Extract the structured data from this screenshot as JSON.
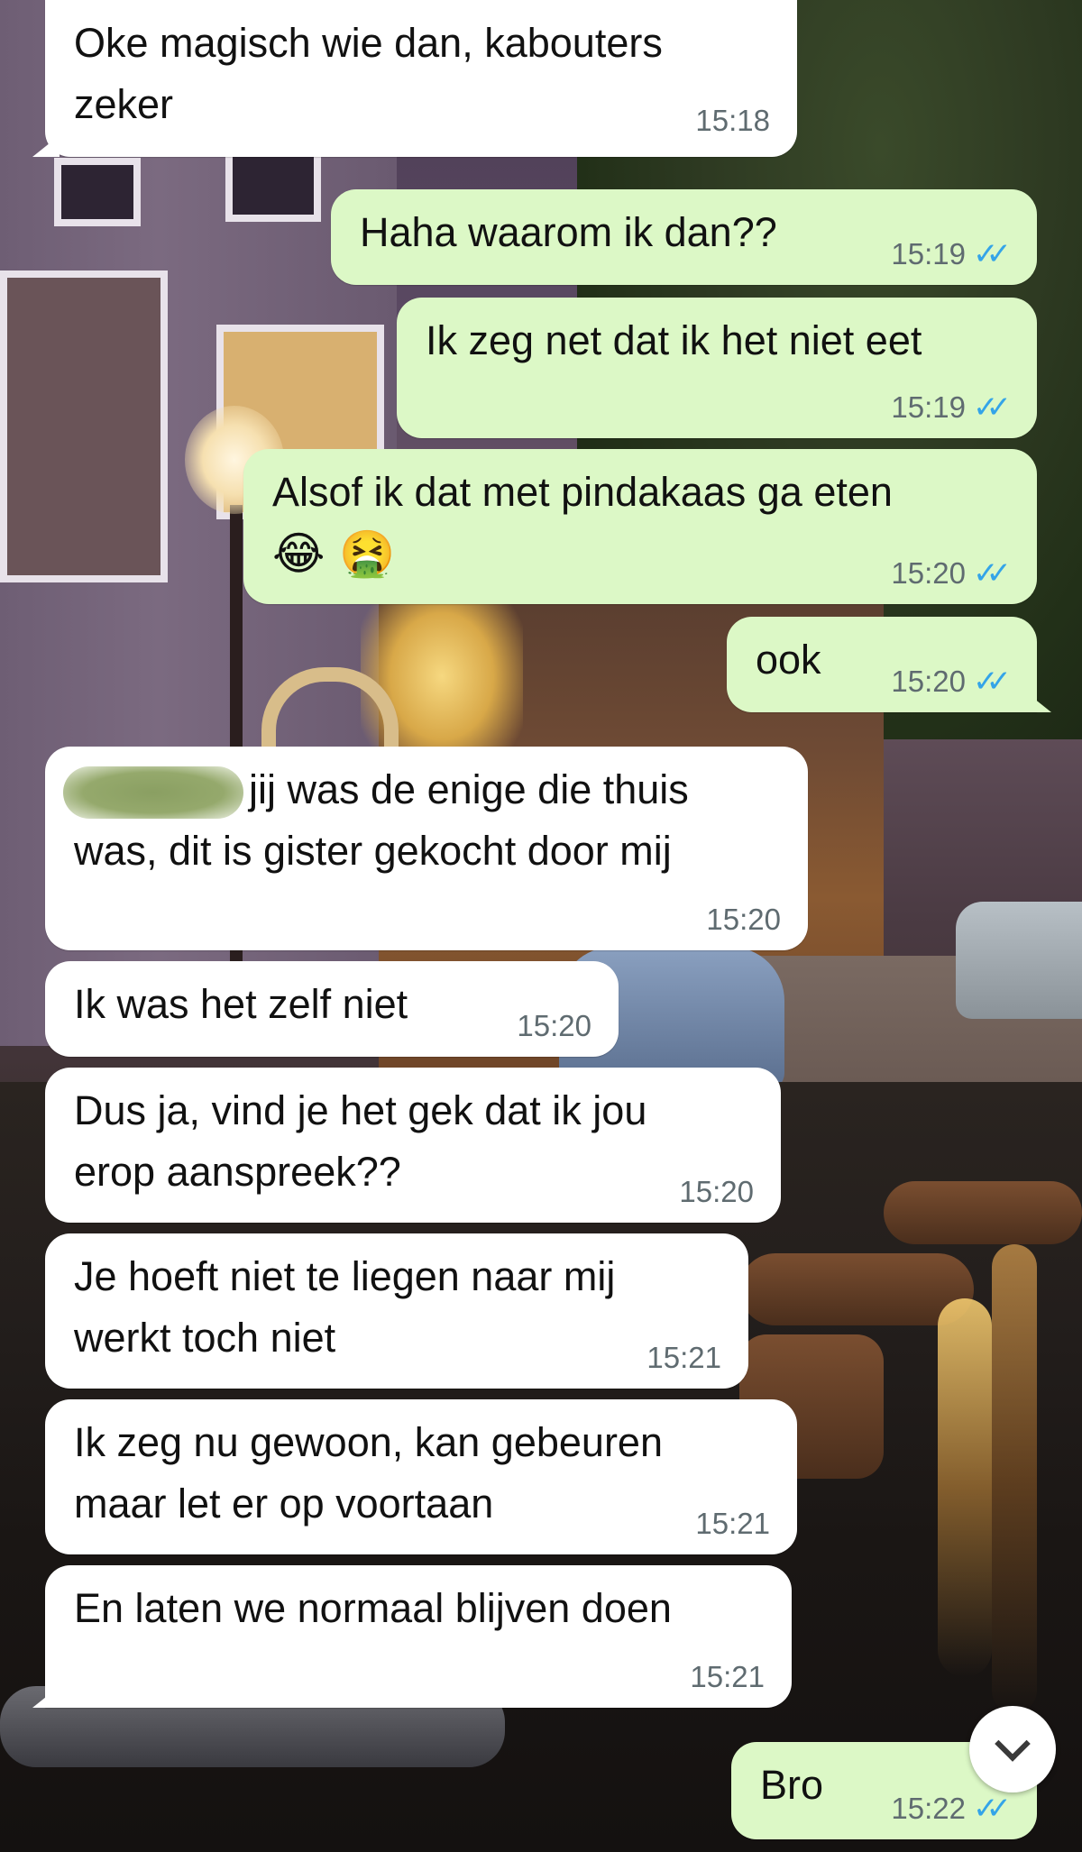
{
  "conversation": {
    "messages": [
      {
        "direction": "incoming",
        "text": "Oke magisch wie dan, kabouters\nzeker",
        "time": "15:18"
      },
      {
        "direction": "outgoing",
        "text": "Haha waarom ik dan??",
        "time": "15:19",
        "status": "read"
      },
      {
        "direction": "outgoing",
        "text": "Ik zeg net dat ik het niet eet",
        "time": "15:19",
        "status": "read"
      },
      {
        "direction": "outgoing",
        "text": "Alsof ik dat met pindakaas ga eten",
        "emoji": "😂 🤮",
        "time": "15:20",
        "status": "read"
      },
      {
        "direction": "outgoing",
        "text": "ook",
        "time": "15:20",
        "status": "read"
      },
      {
        "direction": "incoming",
        "text": "jij was de enige die thuis\nwas, dit is gister gekocht door mij",
        "time": "15:20",
        "redacted_prefix": true
      },
      {
        "direction": "incoming",
        "text": "Ik was het zelf niet",
        "time": "15:20"
      },
      {
        "direction": "incoming",
        "text": "Dus ja, vind je het gek dat ik jou\nerop aanspreek??",
        "time": "15:20"
      },
      {
        "direction": "incoming",
        "text": "Je hoeft niet te liegen naar mij\nwerkt toch niet",
        "time": "15:21"
      },
      {
        "direction": "incoming",
        "text": "Ik zeg nu gewoon, kan gebeuren\nmaar let er op voortaan",
        "time": "15:21"
      },
      {
        "direction": "incoming",
        "text": "En laten we normaal blijven doen",
        "time": "15:21"
      },
      {
        "direction": "outgoing",
        "text": "Bro",
        "time": "15:22",
        "status": "read"
      }
    ]
  },
  "read_ticks": "✓✓",
  "colors": {
    "incoming_bubble": "#ffffff",
    "outgoing_bubble": "#dcf8c6",
    "read_tick": "#34a4e8",
    "timestamp": "#5f6b70"
  },
  "icons": {
    "scroll_down": "chevron-down-icon",
    "read_receipt": "double-check-icon"
  }
}
